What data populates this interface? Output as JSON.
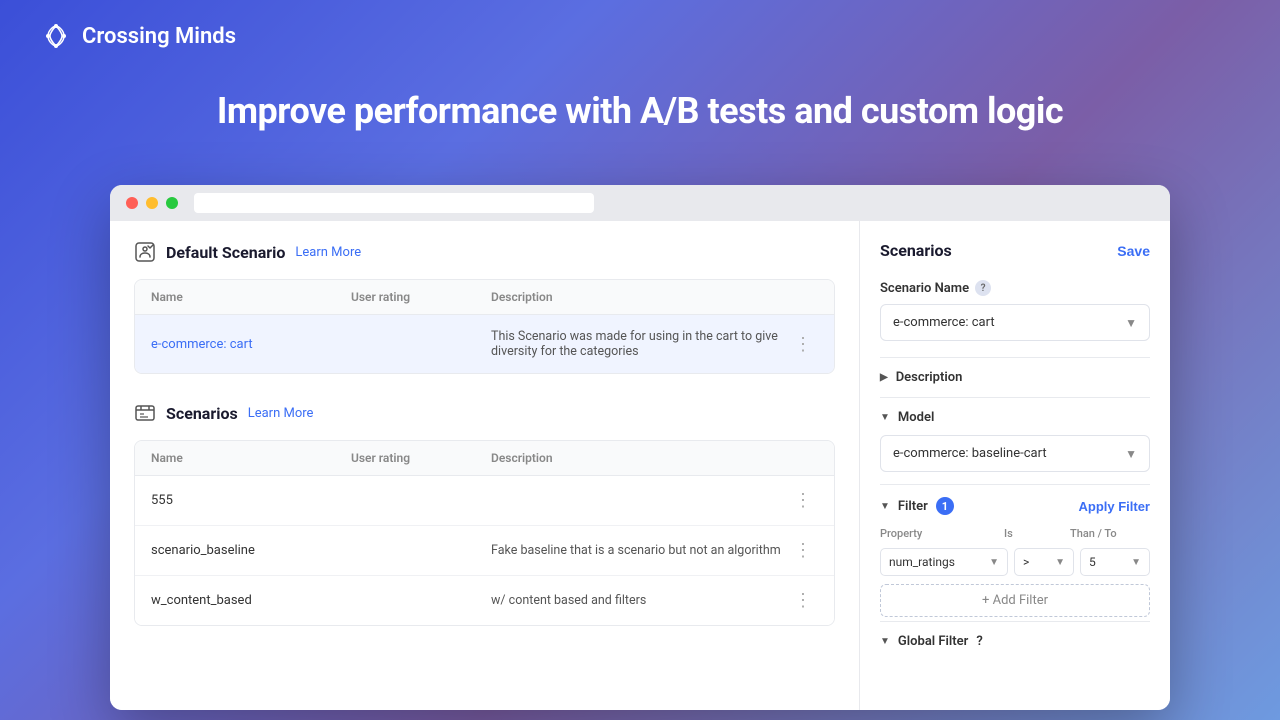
{
  "brand": {
    "name": "Crossing Minds",
    "logo_alt": "Crossing Minds Logo"
  },
  "hero": {
    "title": "Improve performance with A/B tests and custom logic"
  },
  "browser": {
    "url_placeholder": ""
  },
  "default_scenario": {
    "title": "Default Scenario",
    "learn_more": "Learn More",
    "columns": [
      "Name",
      "User rating",
      "Description"
    ],
    "rows": [
      {
        "name": "e-commerce: cart",
        "user_rating": "",
        "description": "This Scenario was made for using in the cart to give diversity for the categories",
        "is_link": true
      }
    ]
  },
  "scenarios": {
    "title": "Scenarios",
    "learn_more": "Learn More",
    "columns": [
      "Name",
      "User rating",
      "Description"
    ],
    "rows": [
      {
        "name": "555",
        "user_rating": "",
        "description": ""
      },
      {
        "name": "scenario_baseline",
        "user_rating": "",
        "description": "Fake baseline that is a scenario but not an algorithm"
      },
      {
        "name": "w_content_based",
        "user_rating": "",
        "description": "w/ content based and filters"
      }
    ]
  },
  "right_panel": {
    "title": "Scenarios",
    "save_label": "Save",
    "scenario_name_label": "Scenario Name",
    "scenario_name_value": "e-commerce: cart",
    "description_label": "Description",
    "model_label": "Model",
    "model_value": "e-commerce: baseline-cart",
    "filter_label": "Filter",
    "filter_badge": "1",
    "apply_filter_label": "Apply Filter",
    "filter_columns": {
      "property": "Property",
      "is": "Is",
      "than_to": "Than / To"
    },
    "filter_row": {
      "property": "num_ratings",
      "operator": ">",
      "value": "5"
    },
    "add_filter_label": "+ Add Filter",
    "global_filter_label": "Global Filter"
  }
}
